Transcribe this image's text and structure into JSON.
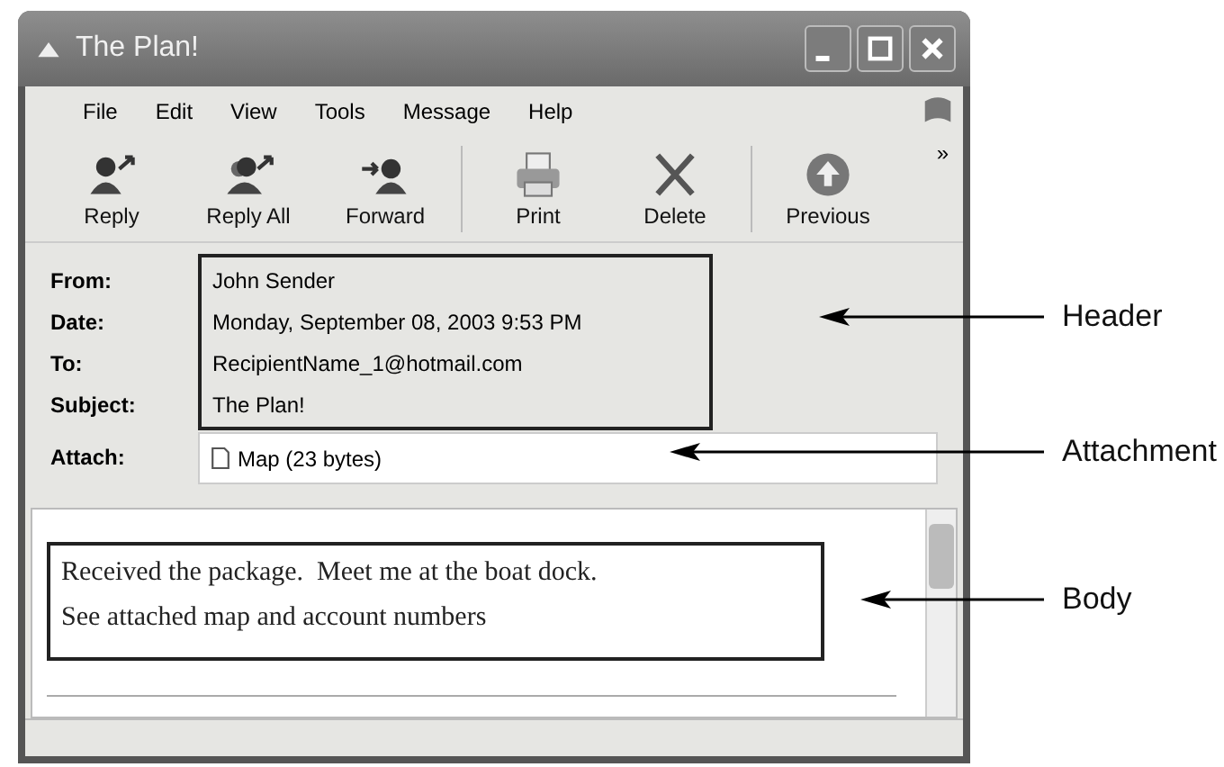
{
  "window": {
    "title": "The Plan!"
  },
  "menu": [
    "File",
    "Edit",
    "View",
    "Tools",
    "Message",
    "Help"
  ],
  "toolbar": [
    [
      {
        "label": "Reply",
        "kind": "reply"
      },
      {
        "label": "Reply All",
        "kind": "reply_all"
      },
      {
        "label": "Forward",
        "kind": "forward"
      }
    ],
    [
      {
        "label": "Print",
        "kind": "print"
      },
      {
        "label": "Delete",
        "kind": "delete"
      }
    ],
    [
      {
        "label": "Previous",
        "kind": "previous"
      }
    ]
  ],
  "toolbar_overflow": "»",
  "header_fields": [
    {
      "label": "From:",
      "value": "John Sender"
    },
    {
      "label": "Date:",
      "value": "Monday, September 08, 2003 9:53 PM"
    },
    {
      "label": "To:",
      "value": "RecipientName_1@hotmail.com"
    },
    {
      "label": "Subject:",
      "value": "The Plan!"
    }
  ],
  "attachment": {
    "label": "Attach:",
    "file": "Map (23 bytes)"
  },
  "body": [
    "Received the package.  Meet me at the boat dock.",
    "See attached map and account numbers"
  ],
  "callouts": [
    "Header",
    "Attachment",
    "Body"
  ]
}
